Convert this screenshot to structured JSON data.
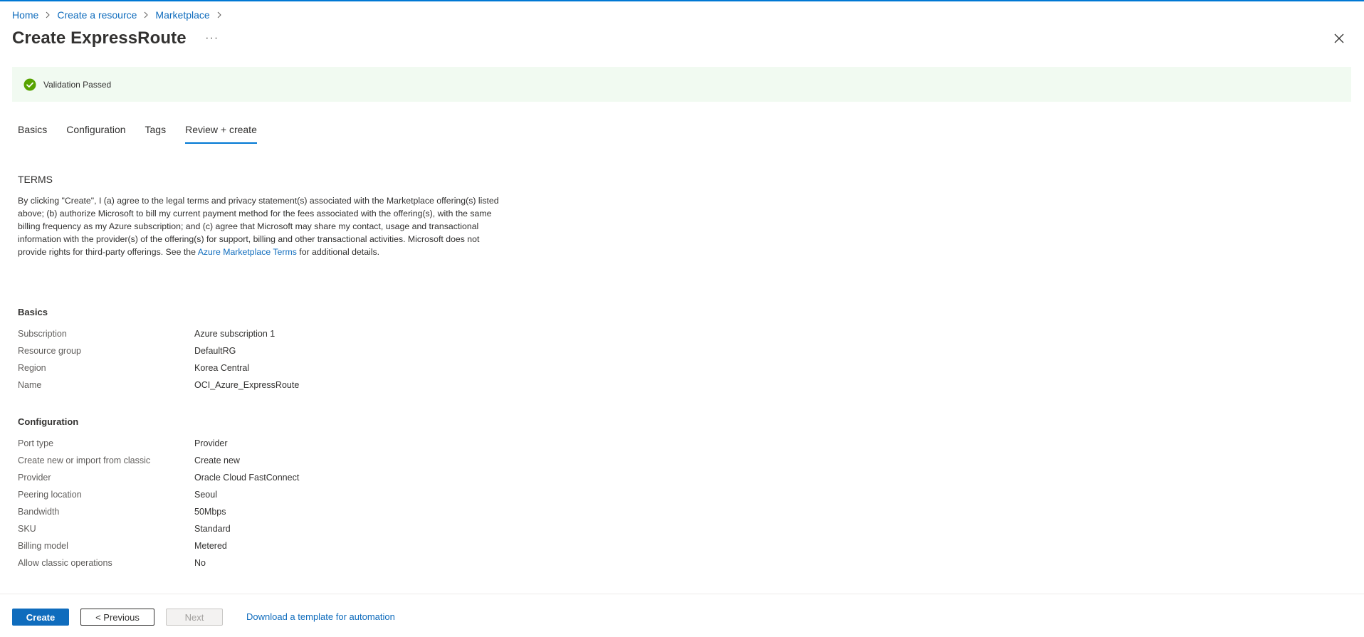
{
  "breadcrumb": {
    "items": [
      {
        "label": "Home"
      },
      {
        "label": "Create a resource"
      },
      {
        "label": "Marketplace"
      }
    ]
  },
  "header": {
    "title": "Create ExpressRoute",
    "more_label": "···"
  },
  "banner": {
    "text": "Validation Passed",
    "color": "#57a300"
  },
  "tabs": [
    {
      "label": "Basics"
    },
    {
      "label": "Configuration"
    },
    {
      "label": "Tags"
    },
    {
      "label": "Review + create",
      "active": true
    }
  ],
  "terms": {
    "heading": "TERMS",
    "text_before": "By clicking \"Create\", I (a) agree to the legal terms and privacy statement(s) associated with the Marketplace offering(s) listed above; (b) authorize Microsoft to bill my current payment method for the fees associated with the offering(s), with the same billing frequency as my Azure subscription; and (c) agree that Microsoft may share my contact, usage and transactional information with the provider(s) of the offering(s) for support, billing and other transactional activities. Microsoft does not provide rights for third-party offerings. See the ",
    "link_text": "Azure Marketplace Terms",
    "text_after": " for additional details."
  },
  "basics": {
    "title": "Basics",
    "rows": [
      {
        "label": "Subscription",
        "value": "Azure subscription 1"
      },
      {
        "label": "Resource group",
        "value": "DefaultRG"
      },
      {
        "label": "Region",
        "value": "Korea Central"
      },
      {
        "label": "Name",
        "value": "OCI_Azure_ExpressRoute"
      }
    ]
  },
  "configuration": {
    "title": "Configuration",
    "rows": [
      {
        "label": "Port type",
        "value": "Provider"
      },
      {
        "label": "Create new or import from classic",
        "value": "Create new"
      },
      {
        "label": "Provider",
        "value": "Oracle Cloud FastConnect"
      },
      {
        "label": "Peering location",
        "value": "Seoul"
      },
      {
        "label": "Bandwidth",
        "value": "50Mbps"
      },
      {
        "label": "SKU",
        "value": "Standard"
      },
      {
        "label": "Billing model",
        "value": "Metered"
      },
      {
        "label": "Allow classic operations",
        "value": "No"
      }
    ]
  },
  "footer": {
    "create_label": "Create",
    "previous_label": "< Previous",
    "next_label": "Next",
    "download_label": "Download a template for automation"
  },
  "colors": {
    "accent": "#0078d4",
    "link": "#0f6cbd",
    "banner_bg": "#f1faf1"
  }
}
